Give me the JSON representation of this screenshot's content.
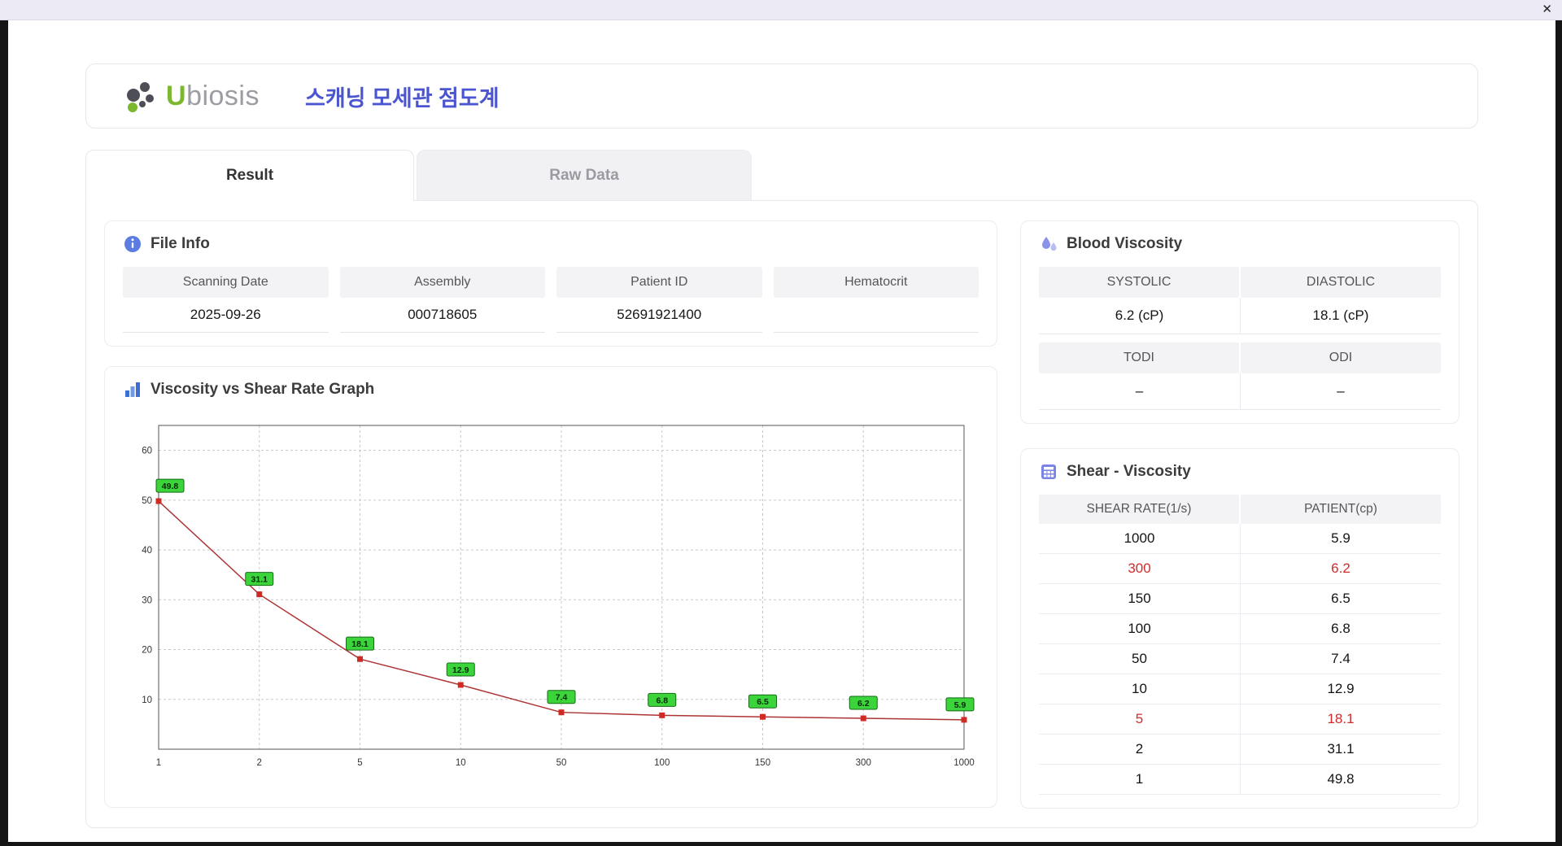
{
  "window": {
    "close": "✕"
  },
  "header": {
    "logo": "Ubiosis",
    "logo_first": "U",
    "logo_rest": "biosis",
    "title": "스캐닝 모세관 점도계"
  },
  "tabs": {
    "result": "Result",
    "raw": "Raw Data"
  },
  "file_info": {
    "title": "File Info",
    "fields": [
      {
        "label": "Scanning Date",
        "value": "2025-09-26"
      },
      {
        "label": "Assembly",
        "value": "000718605"
      },
      {
        "label": "Patient ID",
        "value": "52691921400"
      },
      {
        "label": "Hematocrit",
        "value": ""
      }
    ]
  },
  "blood_viscosity": {
    "title": "Blood Viscosity",
    "rows": [
      {
        "cells": [
          {
            "label": "SYSTOLIC",
            "value": "6.2 (cP)"
          },
          {
            "label": "DIASTOLIC",
            "value": "18.1 (cP)"
          }
        ]
      },
      {
        "cells": [
          {
            "label": "TODI",
            "value": "–"
          },
          {
            "label": "ODI",
            "value": "–"
          }
        ]
      }
    ]
  },
  "graph": {
    "title": "Viscosity vs Shear Rate Graph"
  },
  "chart_data": {
    "type": "line",
    "title": "Viscosity vs Shear Rate Graph",
    "xlabel": "",
    "ylabel": "",
    "x_scale": "category",
    "x_categories": [
      "1",
      "2",
      "5",
      "10",
      "50",
      "100",
      "150",
      "300",
      "1000"
    ],
    "values": [
      49.8,
      31.1,
      18.1,
      12.9,
      7.4,
      6.8,
      6.5,
      6.2,
      5.9
    ],
    "point_labels": [
      "49.8",
      "31.1",
      "18.1",
      "12.9",
      "7.4",
      "6.8",
      "6.5",
      "6.2",
      "5.9"
    ],
    "yticks": [
      10,
      20,
      30,
      40,
      50,
      60
    ],
    "ylim": [
      0,
      65
    ],
    "grid": true,
    "legend": false,
    "line_color": "#ad3434",
    "marker_color": "#cf2b24",
    "label_fill": "#3bd43b",
    "label_border": "#156b15"
  },
  "shear_table": {
    "title": "Shear - Viscosity",
    "columns": [
      "SHEAR RATE(1/s)",
      "PATIENT(cp)"
    ],
    "rows": [
      {
        "shear": "1000",
        "patient": "5.9",
        "highlight": false
      },
      {
        "shear": "300",
        "patient": "6.2",
        "highlight": true
      },
      {
        "shear": "150",
        "patient": "6.5",
        "highlight": false
      },
      {
        "shear": "100",
        "patient": "6.8",
        "highlight": false
      },
      {
        "shear": "50",
        "patient": "7.4",
        "highlight": false
      },
      {
        "shear": "10",
        "patient": "12.9",
        "highlight": false
      },
      {
        "shear": "5",
        "patient": "18.1",
        "highlight": true
      },
      {
        "shear": "2",
        "patient": "31.1",
        "highlight": false
      },
      {
        "shear": "1",
        "patient": "49.8",
        "highlight": false
      }
    ]
  },
  "colors": {
    "accent_blue": "#4a55cf",
    "highlight_red": "#d22b2b",
    "logo_green": "#7cb82f",
    "header_gray": "#f3f3f6"
  }
}
